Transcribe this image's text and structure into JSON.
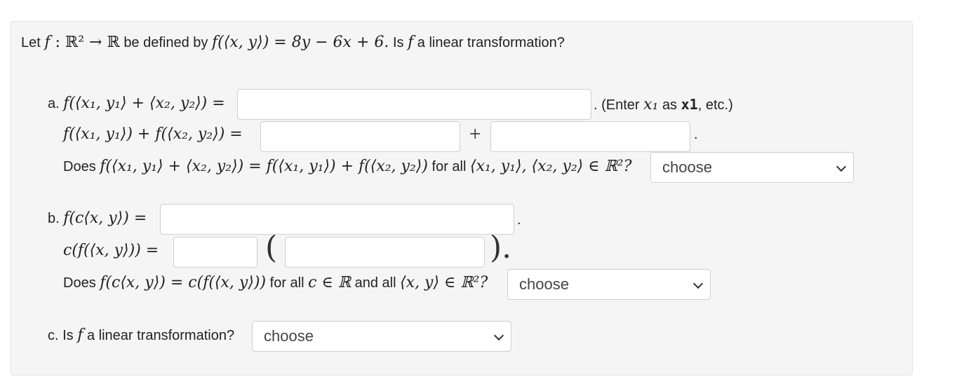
{
  "question": {
    "intro": "Let",
    "f": "f",
    "colon_map": " : ℝ² → ℝ",
    "defined_by": "be defined by",
    "formula": "f(⟨x, y⟩) = 8y − 6x + 6.",
    "question_text": "Is",
    "f2": "f",
    "tail": "a linear transformation?"
  },
  "part_a": {
    "label": "a.",
    "lhs1": "f(⟨x₁, y₁⟩ + ⟨x₂, y₂⟩) =",
    "hint_prefix": ". (Enter",
    "hint_var": "x₁",
    "hint_as": "as",
    "hint_code": "x1",
    "hint_suffix": ", etc.)",
    "lhs2": "f(⟨x₁, y₁⟩) + f(⟨x₂, y₂⟩) =",
    "plus": "+",
    "period": ".",
    "does_prefix": "Does",
    "does_eq": "f(⟨x₁, y₁⟩ + ⟨x₂, y₂⟩) = f(⟨x₁, y₁⟩) + f(⟨x₂, y₂⟩)",
    "for_all": "for all",
    "for_all_vars": "⟨x₁, y₁⟩, ⟨x₂, y₂⟩ ∈ ℝ²?",
    "select_value": "choose"
  },
  "part_b": {
    "label": "b.",
    "lhs1": "f(c⟨x, y⟩) =",
    "period": ".",
    "lhs2": "c(f(⟨x, y⟩)) =",
    "open_paren": "(",
    "close_paren": ").",
    "does_prefix": "Does",
    "does_eq": "f(c⟨x, y⟩) = c(f(⟨x, y⟩))",
    "for_all": "for all",
    "c_in_r": "c ∈ ℝ",
    "and_all": "and all",
    "xy_in_r2": "⟨x, y⟩ ∈ ℝ²?",
    "select_value": "choose"
  },
  "part_c": {
    "label": "c. Is",
    "f": "f",
    "tail": "a linear transformation?",
    "select_value": "choose"
  }
}
